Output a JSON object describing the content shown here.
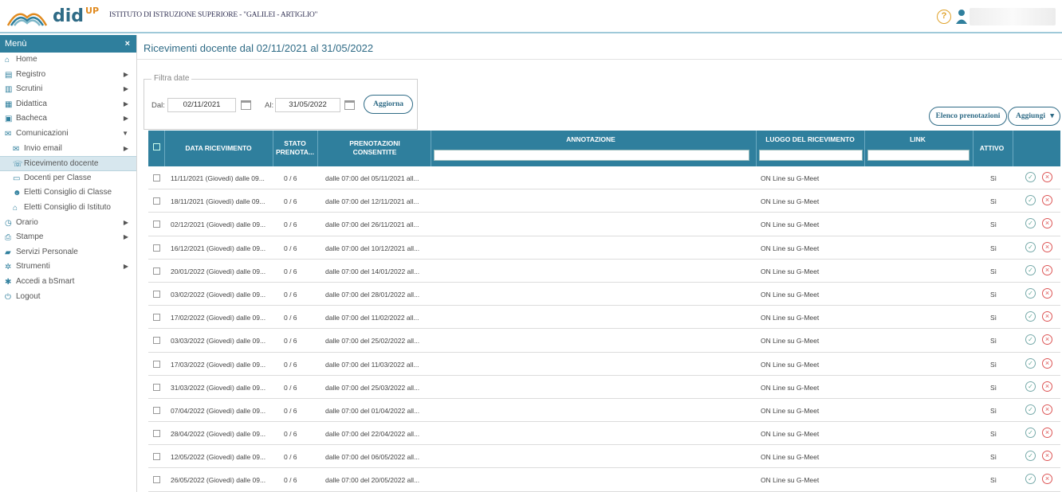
{
  "app": {
    "brand": "did",
    "brand_sup": "UP",
    "school": "ISTITUTO DI ISTRUZIONE SUPERIORE - \"GALILEI - ARTIGLIO\"",
    "help_label": "?"
  },
  "sidebar": {
    "title": "Menù",
    "close_label": "×",
    "items": [
      {
        "label": "Home"
      },
      {
        "label": "Registro"
      },
      {
        "label": "Scrutini"
      },
      {
        "label": "Didattica"
      },
      {
        "label": "Bacheca"
      },
      {
        "label": "Comunicazioni"
      },
      {
        "label": "Invio email"
      },
      {
        "label": "Ricevimento docente"
      },
      {
        "label": "Docenti per Classe"
      },
      {
        "label": "Eletti Consiglio di Classe"
      },
      {
        "label": "Eletti Consiglio di Istituto"
      },
      {
        "label": "Orario"
      },
      {
        "label": "Stampe"
      },
      {
        "label": "Servizi Personale"
      },
      {
        "label": "Strumenti"
      },
      {
        "label": "Accedi a bSmart"
      },
      {
        "label": "Logout"
      }
    ]
  },
  "main": {
    "title": "Ricevimenti docente dal 02/11/2021 al 31/05/2022",
    "filter": {
      "legend": "Filtra date",
      "from_label": "Dal:",
      "from_value": "02/11/2021",
      "to_label": "Al:",
      "to_value": "31/05/2022",
      "update_label": "Aggiorna"
    },
    "buttons": {
      "list_label": "Elenco prenotazioni",
      "add_label": "Aggiungi",
      "add_caret": "▾"
    },
    "columns": {
      "date": "DATA RICEVIMENTO",
      "state": "STATO PRENOTA...",
      "bookings": "PRENOTAZIONI CONSENTITE",
      "note": "ANNOTAZIONE",
      "place": "LUOGO DEL RICEVIMENTO",
      "link": "LINK",
      "active": "ATTIVO"
    },
    "rows": [
      {
        "date": "11/11/2021 (Giovedì) dalle 09...",
        "state": "0 / 6",
        "bookings": "dalle 07:00 del 05/11/2021 all...",
        "place": "ON Line su G-Meet",
        "active": "Sì"
      },
      {
        "date": "18/11/2021 (Giovedì) dalle 09...",
        "state": "0 / 6",
        "bookings": "dalle 07:00 del 12/11/2021 all...",
        "place": "ON Line su G-Meet",
        "active": "Sì"
      },
      {
        "date": "02/12/2021 (Giovedì) dalle 09...",
        "state": "0 / 6",
        "bookings": "dalle 07:00 del 26/11/2021 all...",
        "place": "ON Line su G-Meet",
        "active": "Sì"
      },
      {
        "date": "16/12/2021 (Giovedì) dalle 09...",
        "state": "0 / 6",
        "bookings": "dalle 07:00 del 10/12/2021 all...",
        "place": "ON Line su G-Meet",
        "active": "Sì"
      },
      {
        "date": "20/01/2022 (Giovedì) dalle 09...",
        "state": "0 / 6",
        "bookings": "dalle 07:00 del 14/01/2022 all...",
        "place": "ON Line su G-Meet",
        "active": "Sì"
      },
      {
        "date": "03/02/2022 (Giovedì) dalle 09...",
        "state": "0 / 6",
        "bookings": "dalle 07:00 del 28/01/2022 all...",
        "place": "ON Line su G-Meet",
        "active": "Sì"
      },
      {
        "date": "17/02/2022 (Giovedì) dalle 09...",
        "state": "0 / 6",
        "bookings": "dalle 07:00 del 11/02/2022 all...",
        "place": "ON Line su G-Meet",
        "active": "Sì"
      },
      {
        "date": "03/03/2022 (Giovedì) dalle 09...",
        "state": "0 / 6",
        "bookings": "dalle 07:00 del 25/02/2022 all...",
        "place": "ON Line su G-Meet",
        "active": "Sì"
      },
      {
        "date": "17/03/2022 (Giovedì) dalle 09...",
        "state": "0 / 6",
        "bookings": "dalle 07:00 del 11/03/2022 all...",
        "place": "ON Line su G-Meet",
        "active": "Sì"
      },
      {
        "date": "31/03/2022 (Giovedì) dalle 09...",
        "state": "0 / 6",
        "bookings": "dalle 07:00 del 25/03/2022 all...",
        "place": "ON Line su G-Meet",
        "active": "Sì"
      },
      {
        "date": "07/04/2022 (Giovedì) dalle 09...",
        "state": "0 / 6",
        "bookings": "dalle 07:00 del 01/04/2022 all...",
        "place": "ON Line su G-Meet",
        "active": "Sì"
      },
      {
        "date": "28/04/2022 (Giovedì) dalle 09...",
        "state": "0 / 6",
        "bookings": "dalle 07:00 del 22/04/2022 all...",
        "place": "ON Line su G-Meet",
        "active": "Sì"
      },
      {
        "date": "12/05/2022 (Giovedì) dalle 09...",
        "state": "0 / 6",
        "bookings": "dalle 07:00 del 06/05/2022 all...",
        "place": "ON Line su G-Meet",
        "active": "Sì"
      },
      {
        "date": "26/05/2022 (Giovedì) dalle 09...",
        "state": "0 / 6",
        "bookings": "dalle 07:00 del 20/05/2022 all...",
        "place": "ON Line su G-Meet",
        "active": "Sì"
      }
    ]
  },
  "icons": {
    "logo": "didup-logo-arcs",
    "help": "help-circle-icon",
    "user": "user-icon",
    "calendar": "calendar-icon",
    "check": "check-circle-icon",
    "delete": "x-circle-icon"
  },
  "colors": {
    "primary": "#2f7f9d",
    "accent": "#e0a22a",
    "delete": "#d55555"
  }
}
